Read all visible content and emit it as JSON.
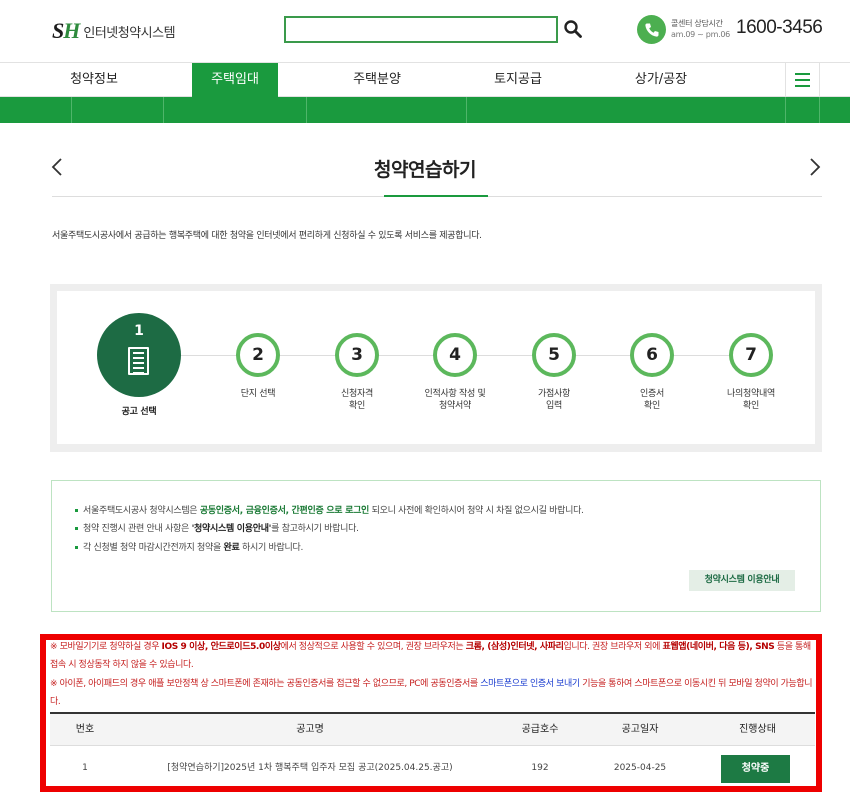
{
  "header": {
    "logo_mark_s": "S",
    "logo_mark_h": "H",
    "logo_text": "인터넷청약시스템",
    "callcenter_title": "콜센터 상담시간",
    "callcenter_hours": "am.09 ~ pm.06",
    "phone_number": "1600-3456"
  },
  "nav": {
    "items": [
      "청약정보",
      "주택임대",
      "주택분양",
      "토지공급",
      "상가/공장"
    ],
    "active_index": 1
  },
  "subnav": {
    "cells": [
      "",
      "",
      "",
      "",
      ""
    ]
  },
  "page": {
    "title": "청약연습하기",
    "intro": "서울주택도시공사에서 공급하는 행복주택에 대한 청약을 인터넷에서 편리하게 신청하실 수 있도록 서비스를 제공합니다."
  },
  "steps": [
    {
      "num": "1",
      "label1": "공고 선택",
      "label2": ""
    },
    {
      "num": "2",
      "label1": "단지 선택",
      "label2": ""
    },
    {
      "num": "3",
      "label1": "신청자격",
      "label2": "확인"
    },
    {
      "num": "4",
      "label1": "인적사항 작성 및",
      "label2": "청약서약"
    },
    {
      "num": "5",
      "label1": "가점사항",
      "label2": "입력"
    },
    {
      "num": "6",
      "label1": "인증서",
      "label2": "확인"
    },
    {
      "num": "7",
      "label1": "나의청약내역",
      "label2": "확인"
    }
  ],
  "notice": {
    "line1_a": "서울주택도시공사 청약시스템은 ",
    "line1_b": "공동인증서, 금융인증서, 간편인증 으로 로그인",
    "line1_c": " 되오니 사전에 확인하시어 청약 시 차질 없으시길 바랍니다.",
    "line2_a": "청약 진행시 관련 안내 사항은 ",
    "line2_b": "'청약시스템 이용안내'",
    "line2_c": "를 참고하시기 바랍니다.",
    "line3_a": "각 신청별 청약 마감시간전까지 청약을 ",
    "line3_b": "완료",
    "line3_c": " 하시기 바랍니다.",
    "guide_button": "청약시스템 이용안내"
  },
  "warnings": {
    "w1_a": "※ 모바일기기로 청약하실 경우 ",
    "w1_b": "IOS 9 이상, 안드로이드5.0이상",
    "w1_c": "에서 정상적으로 사용할 수 있으며, 권장 브라우저는 ",
    "w1_d": "크롬, (삼성)인터넷, 사파리",
    "w1_e": "입니다. 권장 브라우저 외에 ",
    "w1_f": "표웹앱(네이버, 다음 등), SNS",
    "w1_g": " 등을 통해 접속 시 정상동작 하지 않을 수 있습니다.",
    "w2_a": "※ 아이폰, 아이패드의 경우 애플 보안정책 상 스마트폰에 존재하는 공동인증서를 접근할 수 없으므로, PC에 공동인증서를 ",
    "w2_b": "스마트폰으로 인증서 보내기",
    "w2_c": " 기능을 통하여 스마트폰으로 이동시킨 뒤 모바일 청약이 가능합니다."
  },
  "table": {
    "headers": [
      "번호",
      "공고명",
      "공급호수",
      "공고일자",
      "진행상태"
    ],
    "rows": [
      {
        "no": "1",
        "title": "[청약연습하기]2025년 1차 행복주택 입주자 모집 공고(2025.04.25.공고)",
        "units": "192",
        "date": "2025-04-25",
        "status": "청약중"
      }
    ]
  },
  "colors": {
    "brand_green": "#1a9a3e",
    "dark_green": "#1d6b44",
    "highlight_red": "#ee0000"
  },
  "icons": [
    "search-icon",
    "phone-icon",
    "hamburger-menu-icon",
    "chevron-left-icon",
    "chevron-right-icon",
    "document-icon"
  ]
}
